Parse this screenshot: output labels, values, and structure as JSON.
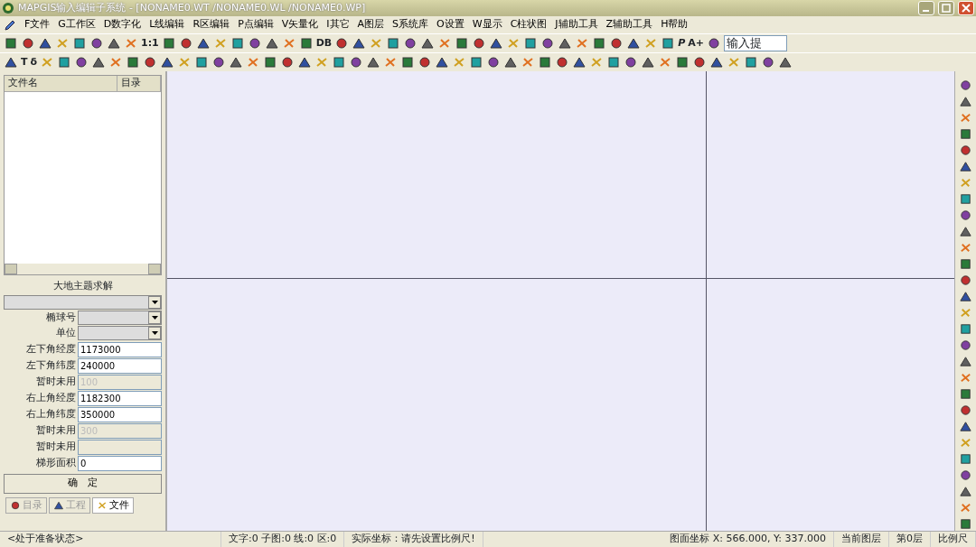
{
  "window": {
    "title": "MAPGIS输入编辑子系统 - [NONAME0.WT /NONAME0.WL /NONAME0.WP]"
  },
  "menu": [
    "F文件",
    "G工作区",
    "D数字化",
    "L线编辑",
    "R区编辑",
    "P点编辑",
    "V矢量化",
    "I其它",
    "A图层",
    "S系统库",
    "O设置",
    "W显示",
    "C柱状图",
    "J辅助工具",
    "Z辅助工具",
    "H帮助"
  ],
  "toolbar1": {
    "labels": [
      "1:1",
      "DB",
      "P",
      "A+"
    ],
    "input": "输入提"
  },
  "toolbar2": {
    "labels": [
      "T",
      "δ"
    ]
  },
  "file_panel": {
    "columns": [
      "文件名",
      "目录"
    ]
  },
  "solver": {
    "title": "大地主题求解",
    "selects": [
      {
        "kind": "wide"
      },
      {
        "kind": "labeled",
        "label": "椭球号"
      },
      {
        "kind": "labeled",
        "label": "单位"
      }
    ],
    "fields": [
      {
        "label": "左下角经度",
        "value": "1173000",
        "disabled": false
      },
      {
        "label": "左下角纬度",
        "value": "240000",
        "disabled": false
      },
      {
        "label": "暂时未用",
        "value": "100",
        "disabled": true
      },
      {
        "label": "右上角经度",
        "value": "1182300",
        "disabled": false
      },
      {
        "label": "右上角纬度",
        "value": "350000",
        "disabled": false
      },
      {
        "label": "暂时未用",
        "value": "300",
        "disabled": true
      },
      {
        "label": "暂时未用",
        "disabled": true
      },
      {
        "label": "梯形面积",
        "value": "0",
        "disabled": false
      }
    ],
    "button": "确　定"
  },
  "panel_tabs": [
    {
      "label": "目录",
      "selected": false
    },
    {
      "label": "工程",
      "selected": false
    },
    {
      "label": "文件",
      "selected": true
    }
  ],
  "status_bar": [
    "<处于准备状态>",
    "文字:0 子图:0 线:0 区:0",
    "实际坐标：请先设置比例尺!",
    "图面坐标 X: 566.000, Y: 337.000",
    "当前图层",
    "第0层",
    "比例尺"
  ]
}
